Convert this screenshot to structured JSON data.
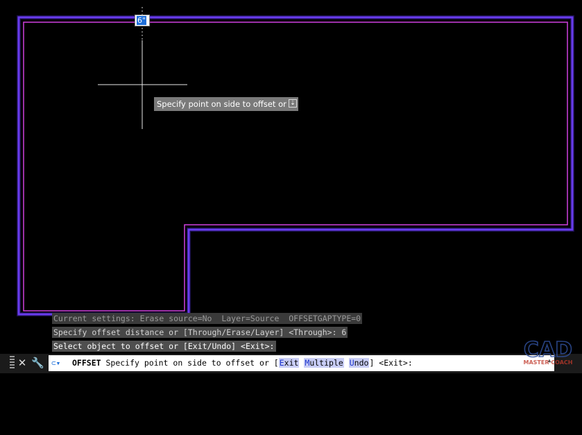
{
  "dynamic_input": {
    "value": "6\""
  },
  "tooltip": {
    "prompt": "Specify point on side to offset or",
    "arrow_glyph": "⇣"
  },
  "history": [
    "Current settings: Erase source=No  Layer=Source  OFFSETGAPTYPE=0",
    "Specify offset distance or [Through/Erase/Layer] <Through>: 6",
    "Select object to offset or [Exit/Undo] <Exit>:"
  ],
  "command_line": {
    "command": "OFFSET",
    "prompt": " Specify point on side to offset or [",
    "options": [
      {
        "hot": "E",
        "rest": "xit"
      },
      {
        "hot": "M",
        "rest": "ultiple"
      },
      {
        "hot": "U",
        "rest": "ndo"
      }
    ],
    "suffix": "] <Exit>:",
    "close_glyph": "✕",
    "wrench_glyph": "🔧",
    "recent_glyph": "⊂▾",
    "scroll_glyph": "▲"
  },
  "logo": {
    "top": "CAD",
    "bottom": "MASTER COACH"
  },
  "colors": {
    "background": "#000000",
    "outline_outer": "#6a3cff",
    "outline_inner": "#d040e0",
    "crosshair": "#ffffff",
    "option_highlight": "#c8cdf6"
  },
  "icons": [
    "close-icon",
    "wrench-icon",
    "recent-commands-icon",
    "scroll-up-icon",
    "dropdown-arrow-icon"
  ]
}
